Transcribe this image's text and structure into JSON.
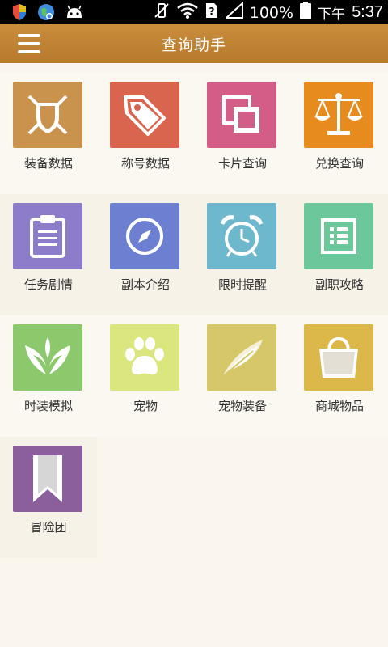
{
  "status_bar": {
    "battery": "100%",
    "ampm": "下午",
    "time": "5:37",
    "left_icons": [
      "shield-icon",
      "globe-icon",
      "android-icon"
    ],
    "right_icons": [
      "vibrate-icon",
      "wifi-icon",
      "notification-icon",
      "signal-icon",
      "battery-icon"
    ]
  },
  "app_bar": {
    "title": "查询助手",
    "menu_icon": "hamburger-icon",
    "color": "#c08433"
  },
  "tiles": [
    {
      "label": "装备数据",
      "icon": "crossed-swords-shield-icon",
      "color": "#c9934e"
    },
    {
      "label": "称号数据",
      "icon": "tag-icon",
      "color": "#d9654f"
    },
    {
      "label": "卡片查询",
      "icon": "cards-icon",
      "color": "#d35d86"
    },
    {
      "label": "兑换查询",
      "icon": "balance-scale-icon",
      "color": "#e88b1f"
    },
    {
      "label": "任务剧情",
      "icon": "clipboard-icon",
      "color": "#8c7cc9"
    },
    {
      "label": "副本介绍",
      "icon": "compass-icon",
      "color": "#6c7fd0"
    },
    {
      "label": "限时提醒",
      "icon": "alarm-clock-icon",
      "color": "#6db8cc"
    },
    {
      "label": "副职攻略",
      "icon": "list-icon",
      "color": "#6cc89a"
    },
    {
      "label": "时装模拟",
      "icon": "wings-icon",
      "color": "#8cc96c"
    },
    {
      "label": "宠物",
      "icon": "paw-icon",
      "color": "#dbe67e"
    },
    {
      "label": "宠物装备",
      "icon": "feather-icon",
      "color": "#d6c869"
    },
    {
      "label": "商城物品",
      "icon": "shopping-bag-icon",
      "color": "#dcb84a"
    },
    {
      "label": "冒险团",
      "icon": "bookmark-icon",
      "color": "#8a5f9c"
    }
  ]
}
